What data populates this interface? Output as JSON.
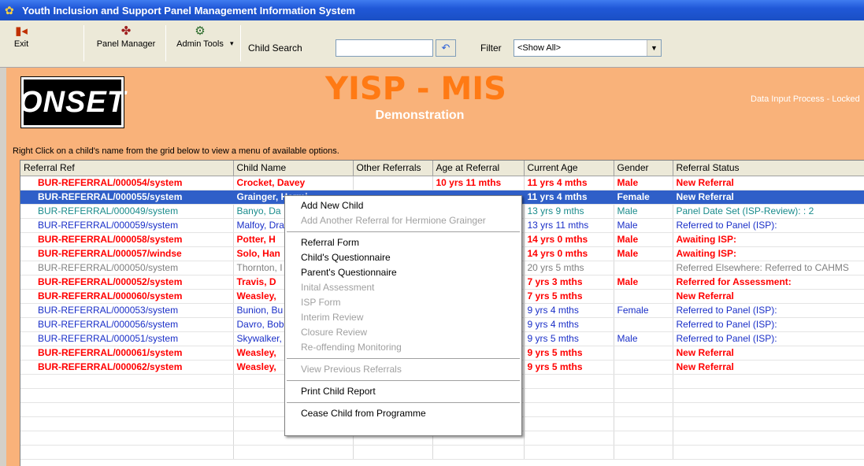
{
  "window": {
    "title": "Youth Inclusion and Support Panel Management Information System"
  },
  "toolbar": {
    "exit_label": "Exit",
    "panel_manager_label": "Panel Manager",
    "admin_tools_label": "Admin Tools",
    "dropdown_glyph": "▾",
    "child_search_label": "Child Search",
    "child_search_value": "",
    "go_glyph": "↶",
    "filter_label": "Filter",
    "filter_value": "<Show All>"
  },
  "banner": {
    "logo": "ONSET",
    "title": "YISP - MIS",
    "subtitle": "Demonstration",
    "status": "Data Input Process - Locked"
  },
  "instruction": "Right Click on a child's name from the grid below to view a menu of available options.",
  "grid": {
    "columns": [
      "Referral Ref",
      "Child Name",
      "Other Referrals",
      "Age at Referral",
      "Current Age",
      "Gender",
      "Referral Status"
    ],
    "rows": [
      {
        "style": "red",
        "ref": "BUR-REFERRAL/000054/system",
        "name": "Crocket, Davey",
        "other": "",
        "age_ref": "10 yrs 11 mths",
        "age_cur": "11 yrs 4 mths",
        "gender": "Male",
        "status": "New Referral"
      },
      {
        "style": "sel",
        "ref": "BUR-REFERRAL/000055/system",
        "name": "Grainger, Hermi",
        "other": "",
        "age_ref": "",
        "age_cur": "11 yrs 4 mths",
        "gender": "Female",
        "status": "New Referral"
      },
      {
        "style": "teal",
        "ref": "BUR-REFERRAL/000049/system",
        "name": "Banyo, Da",
        "other": "",
        "age_ref": "",
        "age_cur": "13 yrs 9 mths",
        "gender": "Male",
        "status": "Panel Date Set (ISP-Review):  : 2"
      },
      {
        "style": "blue",
        "ref": "BUR-REFERRAL/000059/system",
        "name": "Malfoy, Dra",
        "other": "",
        "age_ref": "",
        "age_cur": "13 yrs 11 mths",
        "gender": "Male",
        "status": "Referred to Panel (ISP):"
      },
      {
        "style": "red",
        "ref": "BUR-REFERRAL/000058/system",
        "name": "Potter, H",
        "other": "",
        "age_ref": "",
        "age_cur": "14 yrs 0 mths",
        "gender": "Male",
        "status": "Awaiting ISP:"
      },
      {
        "style": "red",
        "ref": "BUR-REFERRAL/000057/windse",
        "name": "Solo, Han",
        "other": "",
        "age_ref": "",
        "age_cur": "14 yrs 0 mths",
        "gender": "Male",
        "status": "Awaiting ISP:"
      },
      {
        "style": "gray",
        "ref": "BUR-REFERRAL/000050/system",
        "name": "Thornton, I",
        "other": "",
        "age_ref": "",
        "age_cur": "20 yrs 5 mths",
        "gender": "",
        "status": "Referred Elsewhere: Referred to CAHMS"
      },
      {
        "style": "red",
        "ref": "BUR-REFERRAL/000052/system",
        "name": "Travis, D",
        "other": "",
        "age_ref": "",
        "age_cur": "7 yrs 3 mths",
        "gender": "Male",
        "status": "Referred for Assessment:"
      },
      {
        "style": "red",
        "ref": "BUR-REFERRAL/000060/system",
        "name": "Weasley,",
        "other": "",
        "age_ref": "",
        "age_cur": "7 yrs 5 mths",
        "gender": "",
        "status": "New Referral"
      },
      {
        "style": "blue",
        "ref": "BUR-REFERRAL/000053/system",
        "name": "Bunion, Bu",
        "other": "",
        "age_ref": "",
        "age_cur": "9 yrs 4 mths",
        "gender": "Female",
        "status": "Referred to Panel (ISP):"
      },
      {
        "style": "blue",
        "ref": "BUR-REFERRAL/000056/system",
        "name": "Davro, Bob",
        "other": "",
        "age_ref": "",
        "age_cur": "9 yrs 4 mths",
        "gender": "",
        "status": "Referred to Panel (ISP):"
      },
      {
        "style": "blue",
        "ref": "BUR-REFERRAL/000051/system",
        "name": "Skywalker,",
        "other": "",
        "age_ref": "",
        "age_cur": "9 yrs 5 mths",
        "gender": "Male",
        "status": "Referred to Panel (ISP):"
      },
      {
        "style": "red",
        "ref": "BUR-REFERRAL/000061/system",
        "name": "Weasley,",
        "other": "",
        "age_ref": "",
        "age_cur": "9 yrs 5 mths",
        "gender": "",
        "status": "New Referral"
      },
      {
        "style": "red",
        "ref": "BUR-REFERRAL/000062/system",
        "name": "Weasley,",
        "other": "",
        "age_ref": "",
        "age_cur": "9 yrs 5 mths",
        "gender": "",
        "status": "New Referral"
      }
    ],
    "empty_rows": 6
  },
  "context_menu": {
    "groups": [
      [
        {
          "label": "Add New Child",
          "enabled": true
        },
        {
          "label": "Add Another Referral for Hermione   Grainger",
          "enabled": false
        }
      ],
      [
        {
          "label": "Referral Form",
          "enabled": true
        },
        {
          "label": "Child's Questionnaire",
          "enabled": true
        },
        {
          "label": "Parent's Questionnaire",
          "enabled": true
        },
        {
          "label": "Inital Assessment",
          "enabled": false
        },
        {
          "label": "ISP Form",
          "enabled": false
        },
        {
          "label": "Interim Review",
          "enabled": false
        },
        {
          "label": "Closure Review",
          "enabled": false
        },
        {
          "label": "Re-offending Monitoring",
          "enabled": false
        }
      ],
      [
        {
          "label": "View Previous Referrals",
          "enabled": false
        }
      ],
      [
        {
          "label": "Print Child Report",
          "enabled": true
        }
      ],
      [
        {
          "label": "Cease Child from Programme",
          "enabled": true
        }
      ]
    ]
  },
  "colors": {
    "banner_bg": "#f9b27a",
    "title_orange": "#ff7a14",
    "selection": "#2f5fc8",
    "red_text": "#ff0000",
    "teal_text": "#1a8c8c",
    "blue_text": "#1a2fc8"
  },
  "icons": {
    "app": "app-icon",
    "exit": "exit-door-icon",
    "panel_manager": "people-icon",
    "admin_tools": "admin-tools-icon",
    "search_go": "search-go-icon",
    "filter_dropdown": "chevron-down-icon"
  }
}
